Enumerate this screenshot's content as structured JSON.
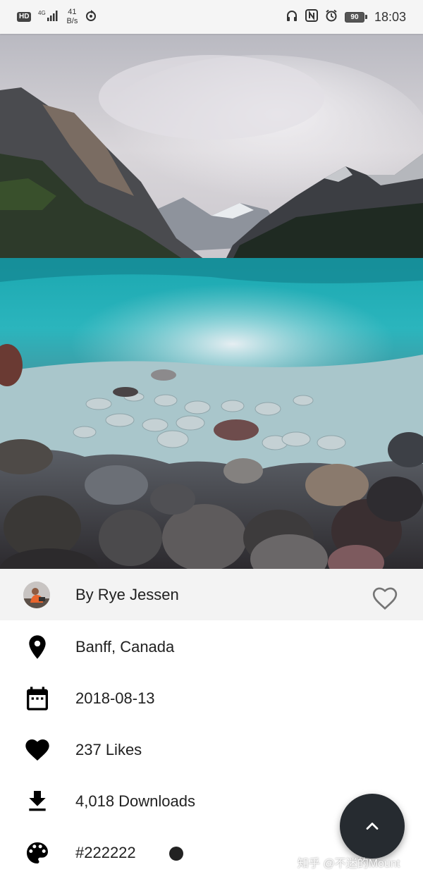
{
  "status_bar": {
    "hd": "HD",
    "network": "4G",
    "speed_value": "41",
    "speed_unit": "B/s",
    "battery": "90",
    "time": "18:03"
  },
  "photo": {
    "alt_icon": "landscape-photo"
  },
  "author": {
    "name": "By Rye Jessen",
    "favorite_icon": "heart-outline-icon"
  },
  "details": {
    "location": "Banff, Canada",
    "date": "2018-08-13",
    "likes": "237 Likes",
    "downloads": "4,018 Downloads",
    "color": "#222222"
  },
  "colors": {
    "swatch": "#222222",
    "fab": "#262b30",
    "author_bar": "#f3f3f3"
  },
  "fab": {
    "icon": "chevron-up-icon"
  },
  "watermark": "知乎 @不迷的Mount"
}
